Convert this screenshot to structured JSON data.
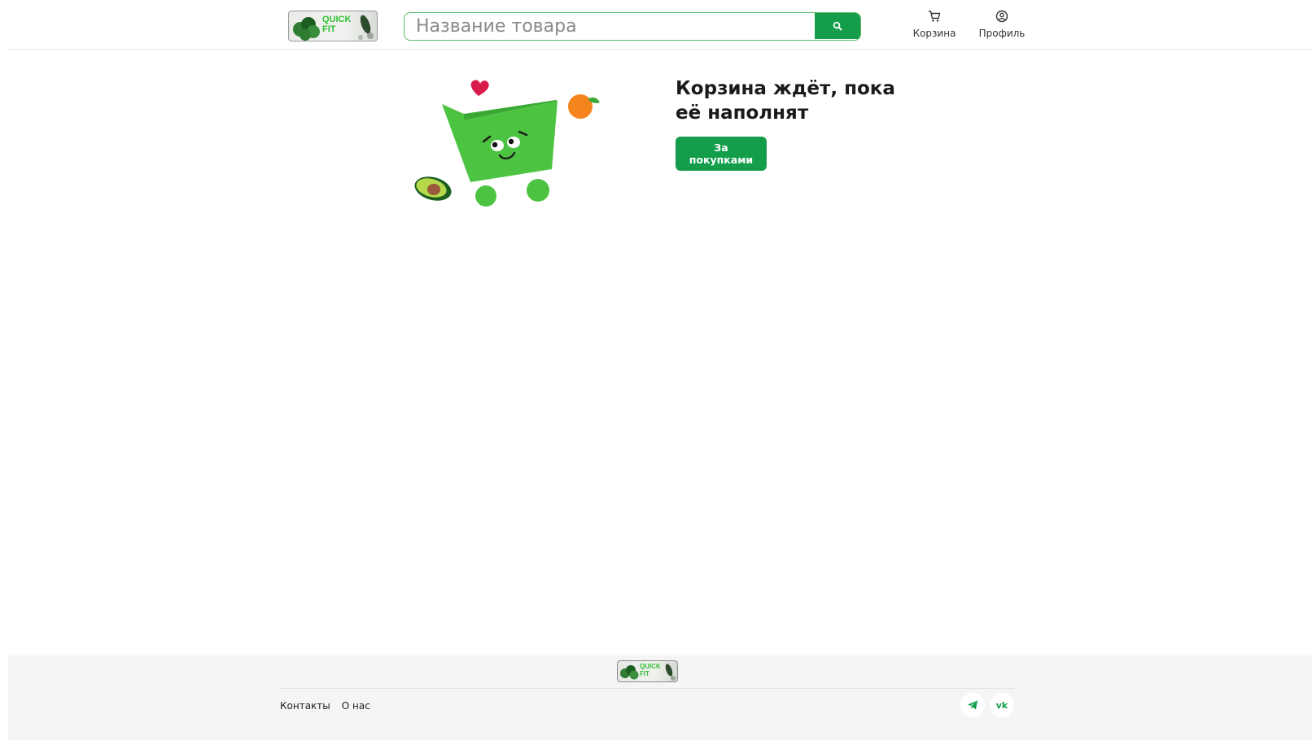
{
  "header": {
    "logo_text_line1": "QUICK",
    "logo_text_line2": "FIT",
    "search": {
      "placeholder": "Название товара",
      "value": ""
    },
    "nav": {
      "cart_label": "Корзина",
      "profile_label": "Профиль"
    }
  },
  "main": {
    "empty_title": "Корзина ждёт, пока её наполнят",
    "cta_label": "За покупками"
  },
  "footer": {
    "logo_text_line1": "QUICK",
    "logo_text_line2": "FIT",
    "links": [
      "Контакты",
      "О нас"
    ],
    "social": [
      "telegram-icon",
      "vk-icon"
    ]
  },
  "colors": {
    "brand_green": "#149e4b",
    "cart_green": "#4cc442",
    "footer_bg": "#f5f5f5",
    "heart": "#d81b4a",
    "orange": "#f5841f"
  }
}
